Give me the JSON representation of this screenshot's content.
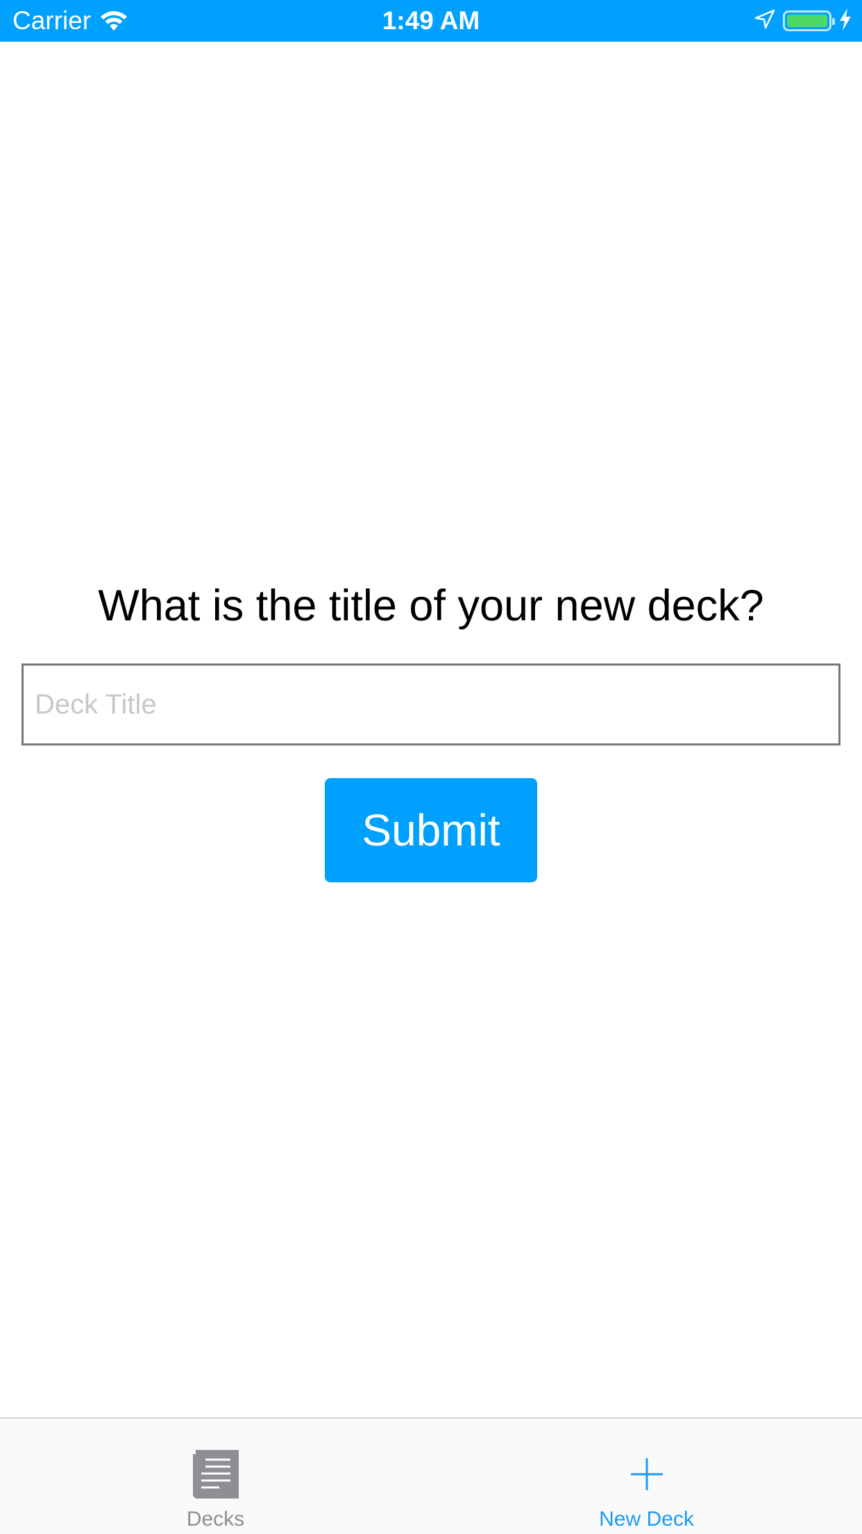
{
  "status_bar": {
    "carrier": "Carrier",
    "time": "1:49 AM",
    "battery_level": 1.0,
    "icons": [
      "wifi-icon",
      "location-arrow-icon",
      "battery-icon",
      "charging-bolt-icon"
    ]
  },
  "main": {
    "question": "What is the title of your new deck?",
    "input": {
      "placeholder": "Deck Title",
      "value": ""
    },
    "submit_label": "Submit"
  },
  "tab_bar": {
    "tabs": [
      {
        "label": "Decks",
        "icon": "document-list-icon",
        "active": false
      },
      {
        "label": "New Deck",
        "icon": "plus-icon",
        "active": true
      }
    ]
  },
  "colors": {
    "accent": "#00a0ff",
    "inactive_tab": "#8e8e93",
    "active_tab": "#1a9bef",
    "battery_fill": "#4cd964"
  }
}
